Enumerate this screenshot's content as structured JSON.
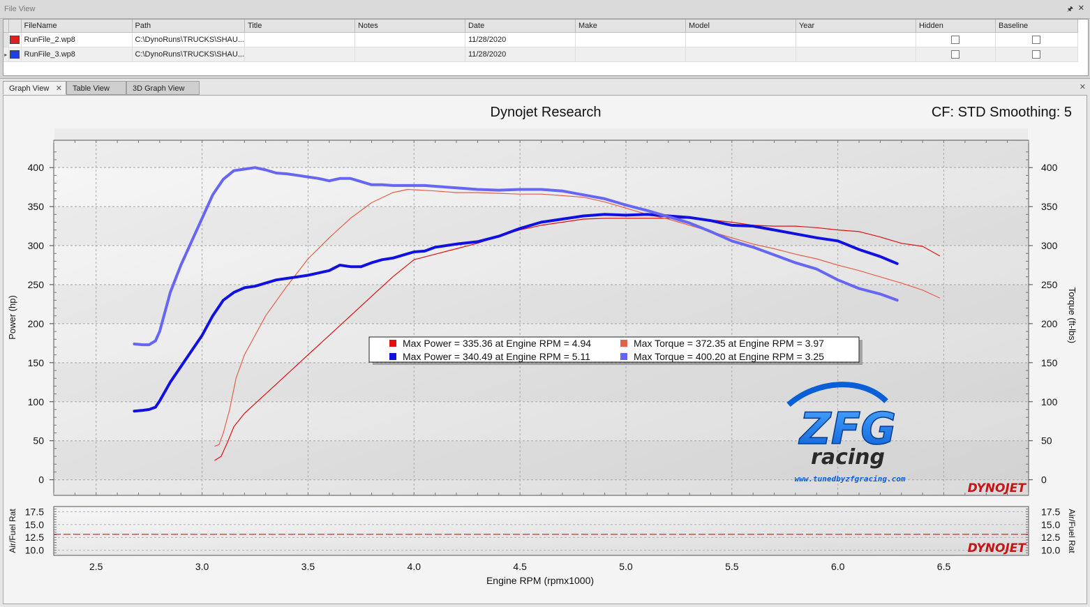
{
  "file_view": {
    "title": "File View",
    "pin_icon": "pin-icon",
    "close_icon": "close-icon",
    "columns": [
      "FileName",
      "Path",
      "Title",
      "Notes",
      "Date",
      "Make",
      "Model",
      "Year",
      "Hidden",
      "Baseline"
    ],
    "rows": [
      {
        "color": "#e02020",
        "filename": "RunFile_2.wp8",
        "path": "C:\\DynoRuns\\TRUCKS\\SHAU...",
        "title": "",
        "notes": "",
        "date": "11/28/2020",
        "make": "",
        "model": "",
        "year": "",
        "hidden": false,
        "baseline": false
      },
      {
        "color": "#2040e0",
        "filename": "RunFile_3.wp8",
        "path": "C:\\DynoRuns\\TRUCKS\\SHAU...",
        "title": "",
        "notes": "",
        "date": "11/28/2020",
        "make": "",
        "model": "",
        "year": "",
        "hidden": false,
        "baseline": false
      }
    ]
  },
  "tabs": [
    {
      "label": "Graph View",
      "active": true
    },
    {
      "label": "Table View",
      "active": false
    },
    {
      "label": "3D Graph View",
      "active": false
    }
  ],
  "colors": {
    "run2_power": "#e01010",
    "run2_torque": "#e5604a",
    "run3_power": "#1010e0",
    "run3_torque": "#6666f2",
    "afr_line": "#e01010"
  },
  "chart_data": {
    "type": "line",
    "title": "Dynojet Research",
    "header_right": "CF: STD Smoothing: 5",
    "xlabel": "Engine RPM (rpmx1000)",
    "ylabel_left": "Power (hp)",
    "ylabel_right": "Torque (ft-lbs)",
    "xlim": [
      2.3,
      6.9
    ],
    "ylim": [
      -20,
      435
    ],
    "x_ticks": [
      "2.5",
      "3.0",
      "3.5",
      "4.0",
      "4.5",
      "5.0",
      "5.5",
      "6.0",
      "6.5"
    ],
    "y_ticks": [
      "0",
      "50",
      "100",
      "150",
      "200",
      "250",
      "300",
      "350",
      "400"
    ],
    "grid": true,
    "legend": [
      "Max Power = 335.36 at Engine RPM = 4.94",
      "Max Torque = 372.35 at Engine RPM = 3.97",
      "Max Power = 340.49 at Engine RPM = 5.11",
      "Max Torque = 400.20 at Engine RPM = 3.25"
    ],
    "series": [
      {
        "x": [
          3.06,
          3.09,
          3.12,
          3.15,
          3.2,
          3.3,
          3.4,
          3.5,
          3.6,
          3.7,
          3.8,
          3.9,
          4.0,
          4.1,
          4.2,
          4.3,
          4.4,
          4.5,
          4.6,
          4.7,
          4.8,
          4.9,
          5.0,
          5.1,
          5.2,
          5.3,
          5.4,
          5.5,
          5.6,
          5.7,
          5.8,
          5.9,
          6.0,
          6.1,
          6.2,
          6.3,
          6.4,
          6.48
        ],
        "values": [
          25,
          30,
          48,
          68,
          85,
          110,
          135,
          160,
          185,
          210,
          235,
          260,
          282,
          289,
          296,
          303,
          312,
          320,
          326,
          330,
          334,
          335,
          335,
          335,
          335,
          335,
          333,
          330,
          326,
          325,
          325,
          323,
          320,
          318,
          311,
          303,
          299,
          287
        ]
      },
      {
        "x": [
          3.06,
          3.08,
          3.1,
          3.13,
          3.16,
          3.2,
          3.3,
          3.4,
          3.5,
          3.6,
          3.7,
          3.8,
          3.9,
          3.97,
          4.1,
          4.2,
          4.3,
          4.4,
          4.5,
          4.6,
          4.7,
          4.8,
          4.9,
          5.0,
          5.1,
          5.2,
          5.3,
          5.4,
          5.5,
          5.6,
          5.7,
          5.8,
          5.9,
          6.0,
          6.1,
          6.2,
          6.3,
          6.4,
          6.48
        ],
        "values": [
          43,
          45,
          60,
          90,
          130,
          160,
          210,
          248,
          283,
          310,
          335,
          355,
          368,
          372,
          370,
          368,
          368,
          367,
          366,
          366,
          364,
          362,
          356,
          348,
          340,
          334,
          326,
          318,
          310,
          302,
          296,
          289,
          283,
          275,
          268,
          260,
          252,
          243,
          233
        ]
      },
      {
        "x": [
          2.68,
          2.72,
          2.75,
          2.78,
          2.8,
          2.85,
          2.9,
          2.95,
          3.0,
          3.05,
          3.1,
          3.15,
          3.2,
          3.25,
          3.3,
          3.35,
          3.4,
          3.45,
          3.5,
          3.55,
          3.6,
          3.65,
          3.7,
          3.75,
          3.8,
          3.85,
          3.9,
          3.95,
          4.0,
          4.05,
          4.1,
          4.2,
          4.3,
          4.4,
          4.5,
          4.6,
          4.7,
          4.8,
          4.9,
          5.0,
          5.1,
          5.2,
          5.3,
          5.4,
          5.5,
          5.6,
          5.7,
          5.8,
          5.9,
          6.0,
          6.1,
          6.2,
          6.28
        ],
        "values": [
          88,
          89,
          90,
          93,
          101,
          125,
          145,
          165,
          185,
          210,
          230,
          240,
          246,
          248,
          252,
          256,
          258,
          260,
          262,
          265,
          268,
          275,
          273,
          273,
          278,
          282,
          284,
          288,
          292,
          293,
          298,
          302,
          305,
          312,
          322,
          330,
          334,
          338,
          340,
          339,
          340,
          338,
          336,
          332,
          326,
          325,
          320,
          315,
          310,
          306,
          295,
          286,
          277
        ]
      },
      {
        "x": [
          2.68,
          2.72,
          2.75,
          2.78,
          2.8,
          2.82,
          2.85,
          2.9,
          2.95,
          3.0,
          3.05,
          3.1,
          3.15,
          3.2,
          3.25,
          3.3,
          3.35,
          3.4,
          3.45,
          3.5,
          3.55,
          3.6,
          3.65,
          3.7,
          3.75,
          3.8,
          3.85,
          3.9,
          3.95,
          4.0,
          4.05,
          4.1,
          4.2,
          4.3,
          4.4,
          4.5,
          4.6,
          4.7,
          4.8,
          4.9,
          5.0,
          5.1,
          5.2,
          5.3,
          5.4,
          5.5,
          5.6,
          5.7,
          5.8,
          5.9,
          6.0,
          6.1,
          6.2,
          6.28
        ],
        "values": [
          174,
          173,
          173,
          178,
          190,
          210,
          240,
          275,
          305,
          335,
          365,
          385,
          396,
          398,
          400,
          397,
          393,
          392,
          390,
          388,
          386,
          383,
          386,
          386,
          382,
          378,
          378,
          377,
          377,
          377,
          377,
          376,
          374,
          372,
          371,
          372,
          372,
          370,
          365,
          360,
          352,
          345,
          337,
          329,
          318,
          306,
          298,
          288,
          278,
          270,
          256,
          245,
          238,
          230
        ]
      }
    ]
  },
  "afr_chart": {
    "ylabel": "Air/Fuel Rat",
    "ylim": [
      9.0,
      18.5
    ],
    "y_ticks": [
      "10.0",
      "12.5",
      "15.0",
      "17.5"
    ],
    "target_value": 13.1
  },
  "brand_watermark": "DYNOJET",
  "logo": {
    "main": "ZFG",
    "sub": "racing",
    "url": "www.tunedbyzfgracing.com"
  }
}
